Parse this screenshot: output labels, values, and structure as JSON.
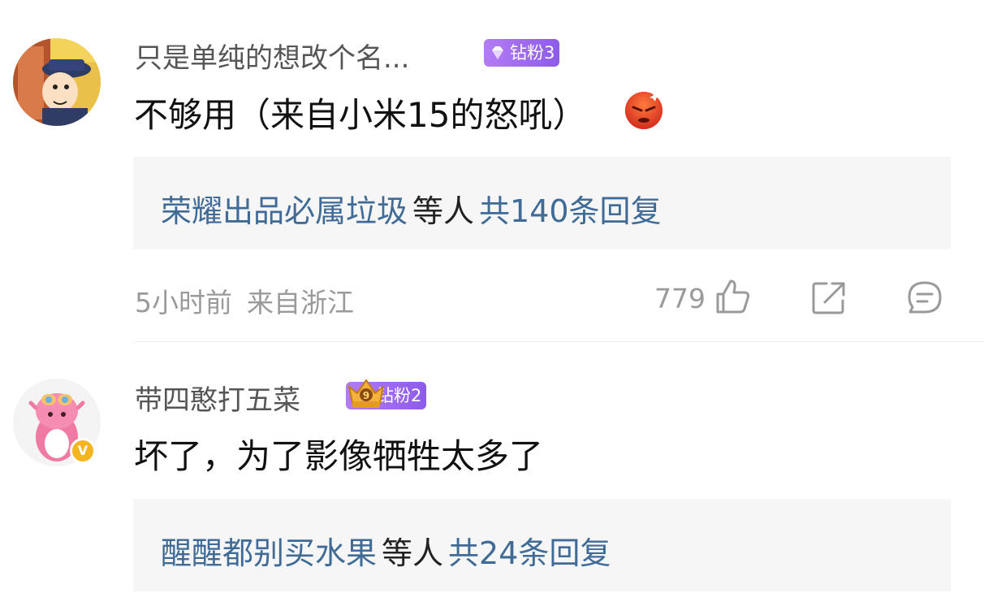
{
  "comments": [
    {
      "username": "只是单纯的想改个名...",
      "badge": "钻粉3",
      "content": "不够用（来自小米15的怒吼）",
      "content_emoji": "angry-face-emoji",
      "reply_preview": {
        "user": "荣耀出品必属垃圾",
        "separator": "等人",
        "count_text": "共140条回复"
      },
      "time": "5小时前",
      "location": "来自浙江",
      "likes": "779",
      "icons": [
        "thumbs-up-icon",
        "share-icon",
        "comment-icon"
      ]
    },
    {
      "username": "带四憨打五菜",
      "badge": "钻粉2",
      "verified_mark": "V",
      "content": "坏了，为了影像牺牲太多了",
      "reply_preview": {
        "user": "醒醒都别买水果",
        "separator": "等人",
        "count_text": "共24条回复"
      }
    }
  ],
  "colors": {
    "link": "#3f6b96",
    "badge_purple": "#9a63ef",
    "meta_gray": "#9a9a9a",
    "reply_bg": "#f6f6f6"
  }
}
